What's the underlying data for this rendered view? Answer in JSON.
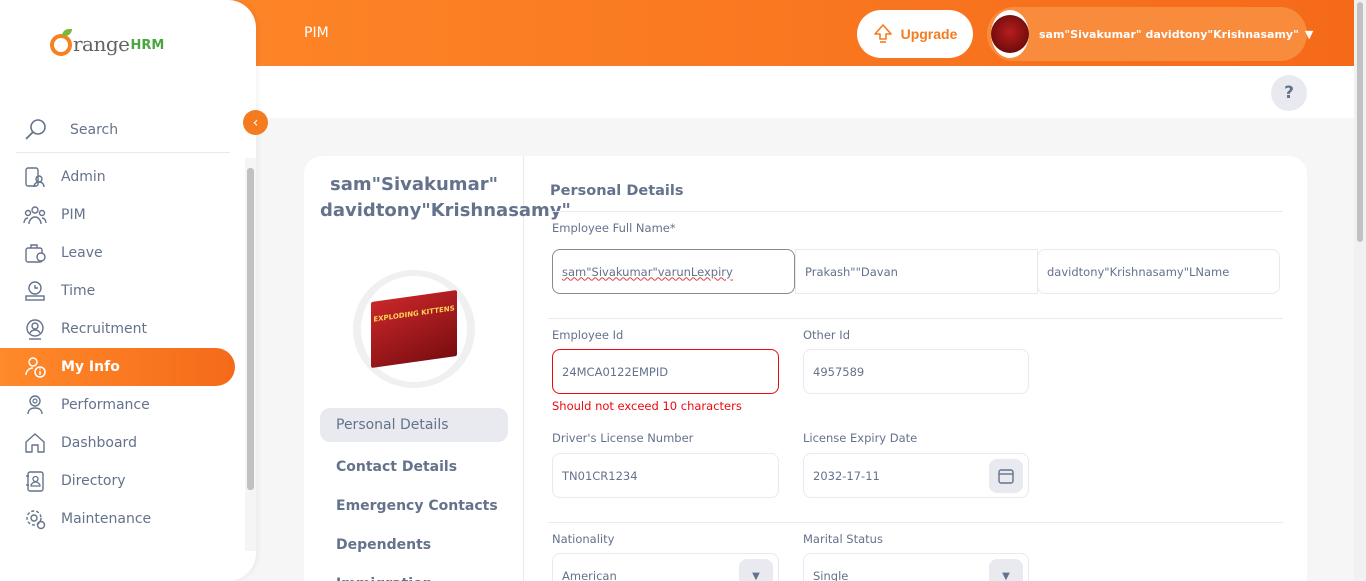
{
  "header": {
    "module_title": "PIM",
    "upgrade_label": "Upgrade",
    "user_name": "sam\"Sivakumar\" davidtony\"Krishnasamy\"",
    "help_label": "?"
  },
  "sidebar": {
    "brand": {
      "part1": "range",
      "part2": "HRM"
    },
    "search_label": "Search",
    "items": [
      {
        "label": "Admin",
        "icon": "admin-icon"
      },
      {
        "label": "PIM",
        "icon": "pim-icon"
      },
      {
        "label": "Leave",
        "icon": "leave-icon"
      },
      {
        "label": "Time",
        "icon": "time-icon"
      },
      {
        "label": "Recruitment",
        "icon": "recruitment-icon"
      },
      {
        "label": "My Info",
        "icon": "my-info-icon",
        "active": true
      },
      {
        "label": "Performance",
        "icon": "performance-icon"
      },
      {
        "label": "Dashboard",
        "icon": "dashboard-icon"
      },
      {
        "label": "Directory",
        "icon": "directory-icon"
      },
      {
        "label": "Maintenance",
        "icon": "maintenance-icon"
      }
    ]
  },
  "profile": {
    "name": "sam\"Sivakumar\" davidtony\"Krishnasamy\"",
    "photo_text": "EXPLODING KITTENS",
    "tabs": [
      "Personal Details",
      "Contact Details",
      "Emergency Contacts",
      "Dependents",
      "Immigration"
    ]
  },
  "form": {
    "title": "Personal Details",
    "full_name_label": "Employee Full Name*",
    "first_name": "sam\"Sivakumar\"varunLexpiry",
    "middle_name": "Prakash\"\"Davan",
    "last_name": "davidtony\"Krishnasamy\"LName",
    "employee_id_label": "Employee Id",
    "employee_id": "24MCA0122EMPID",
    "employee_id_error": "Should not exceed 10 characters",
    "other_id_label": "Other Id",
    "other_id": "4957589",
    "license_label": "Driver's License Number",
    "license": "TN01CR1234",
    "license_expiry_label": "License Expiry Date",
    "license_expiry": "2032-17-11",
    "nationality_label": "Nationality",
    "nationality": "American",
    "marital_label": "Marital Status",
    "marital": "Single"
  },
  "colors": {
    "accent": "#f57b20",
    "error": "#eb0910",
    "text": "#64728c"
  }
}
